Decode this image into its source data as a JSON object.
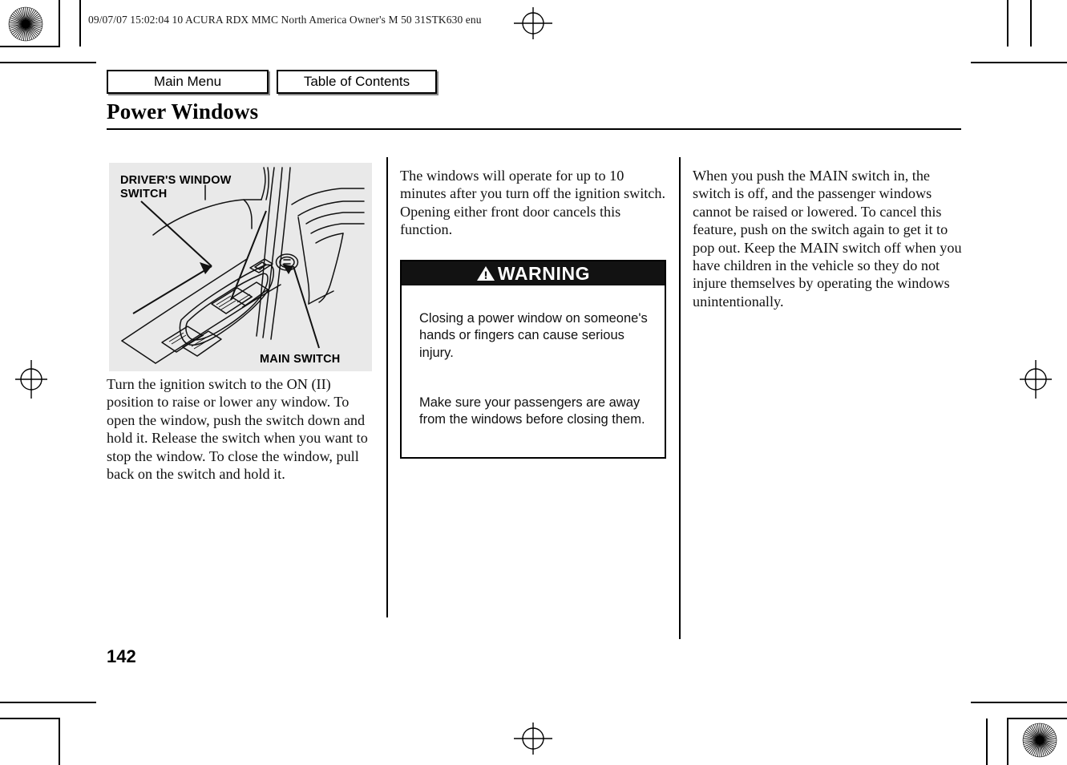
{
  "print_header": "09/07/07 15:02:04    10 ACURA RDX MMC North America Owner's M 50 31STK630 enu",
  "nav": {
    "main_menu": "Main Menu",
    "table_of_contents": "Table of Contents"
  },
  "page": {
    "title": "Power Windows",
    "number": "142"
  },
  "illustration": {
    "label_top": "DRIVER'S WINDOW\nSWITCH",
    "label_bottom": "MAIN SWITCH",
    "background_color": "#e9e9e9"
  },
  "columns": {
    "left_body": "Turn the ignition switch to the ON (II) position to raise or lower any window. To open the window, push the switch down and hold it. Release the switch when you want to stop the window. To close the window, pull back on the switch and hold it.",
    "middle_body": "The windows will operate for up to 10 minutes after you turn off the ignition switch. Opening either front door cancels this function.",
    "right_body": "When you push the MAIN switch in, the switch is off, and the passenger windows cannot be raised or lowered. To cancel this feature, push on the switch again to get it to pop out. Keep the MAIN switch off when you have children in the vehicle so they do not injure themselves by operating the windows unintentionally."
  },
  "warning": {
    "title": "WARNING",
    "icon": "warning-triangle-icon",
    "paragraph_1": "Closing a power window on someone's hands or fingers can cause serious injury.",
    "paragraph_2": "Make sure your passengers are away from the windows before closing them.",
    "bar_color": "#121212",
    "text_color": "#ffffff"
  }
}
